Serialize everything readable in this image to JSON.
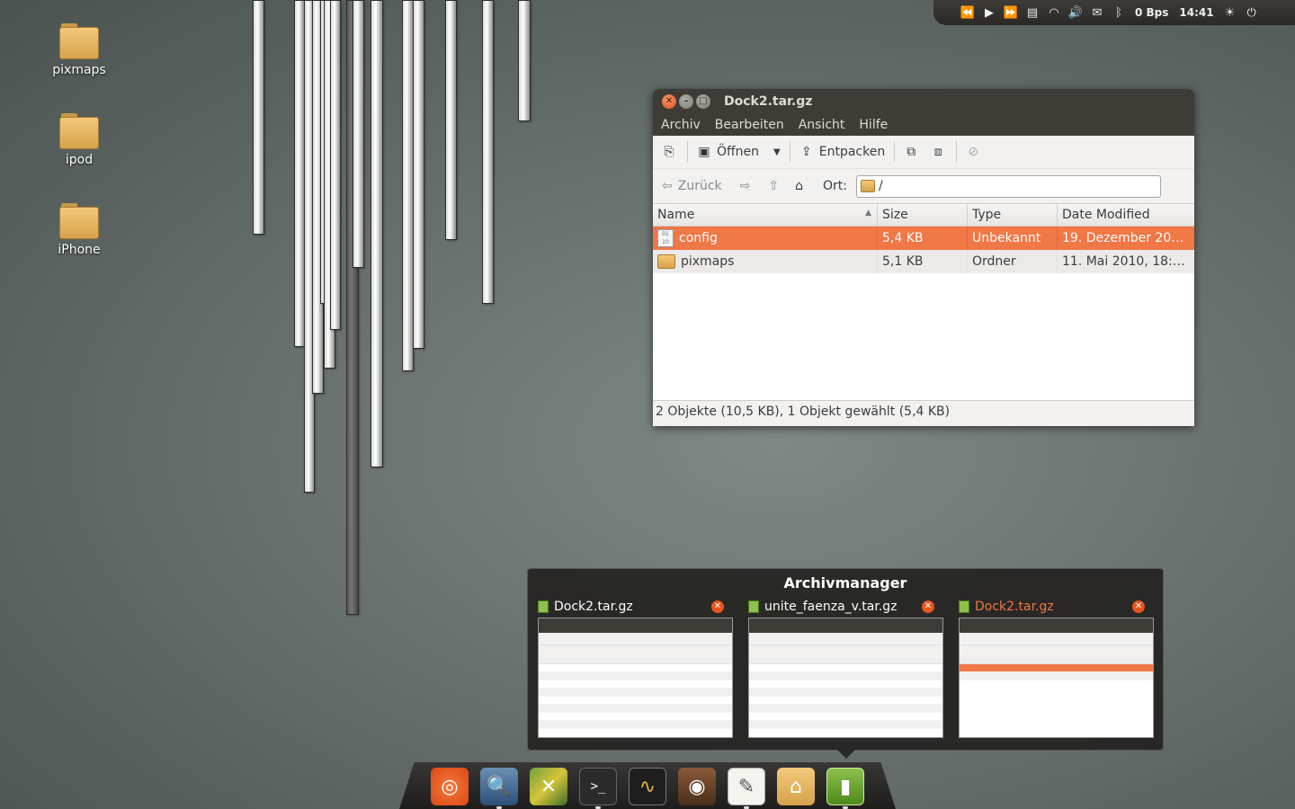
{
  "top_panel": {
    "net_speed": "0 Bps",
    "clock": "14:41",
    "icons": [
      "rewind-icon",
      "play-icon",
      "fast-forward-icon",
      "notes-icon",
      "wifi-icon",
      "volume-icon",
      "mail-icon",
      "bluetooth-icon",
      "weather-icon",
      "power-icon"
    ]
  },
  "desktop": {
    "icons": [
      {
        "label": "pixmaps"
      },
      {
        "label": "ipod"
      },
      {
        "label": "iPhone"
      }
    ]
  },
  "window": {
    "title": "Dock2.tar.gz",
    "menu": [
      "Archiv",
      "Bearbeiten",
      "Ansicht",
      "Hilfe"
    ],
    "toolbar": {
      "open_label": "Öffnen",
      "extract_label": "Entpacken"
    },
    "location": {
      "back_label": "Zurück",
      "ort_label": "Ort:",
      "path": "/"
    },
    "columns": [
      "Name",
      "Size",
      "Type",
      "Date Modified"
    ],
    "rows": [
      {
        "name": "config",
        "size": "5,4 KB",
        "type": "Unbekannt",
        "date": "19. Dezember 201…",
        "selected": true
      },
      {
        "name": "pixmaps",
        "size": "5,1 KB",
        "type": "Ordner",
        "date": "11. Mai 2010, 18:19",
        "selected": false
      }
    ],
    "status": "2 Objekte (10,5 KB), 1 Objekt gewählt (5,4 KB)"
  },
  "switcher": {
    "title": "Archivmanager",
    "windows": [
      {
        "name": "Dock2.tar.gz",
        "active": false
      },
      {
        "name": "unite_faenza_v.tar.gz",
        "active": false
      },
      {
        "name": "Dock2.tar.gz",
        "active": true
      }
    ],
    "active_color": "#f07746"
  },
  "dock": {
    "items": [
      "ubuntu-icon",
      "image-viewer-icon",
      "maps-icon",
      "terminal-icon",
      "system-monitor-icon",
      "speaker-icon",
      "text-editor-icon",
      "home-folder-icon",
      "archive-manager-icon"
    ]
  }
}
